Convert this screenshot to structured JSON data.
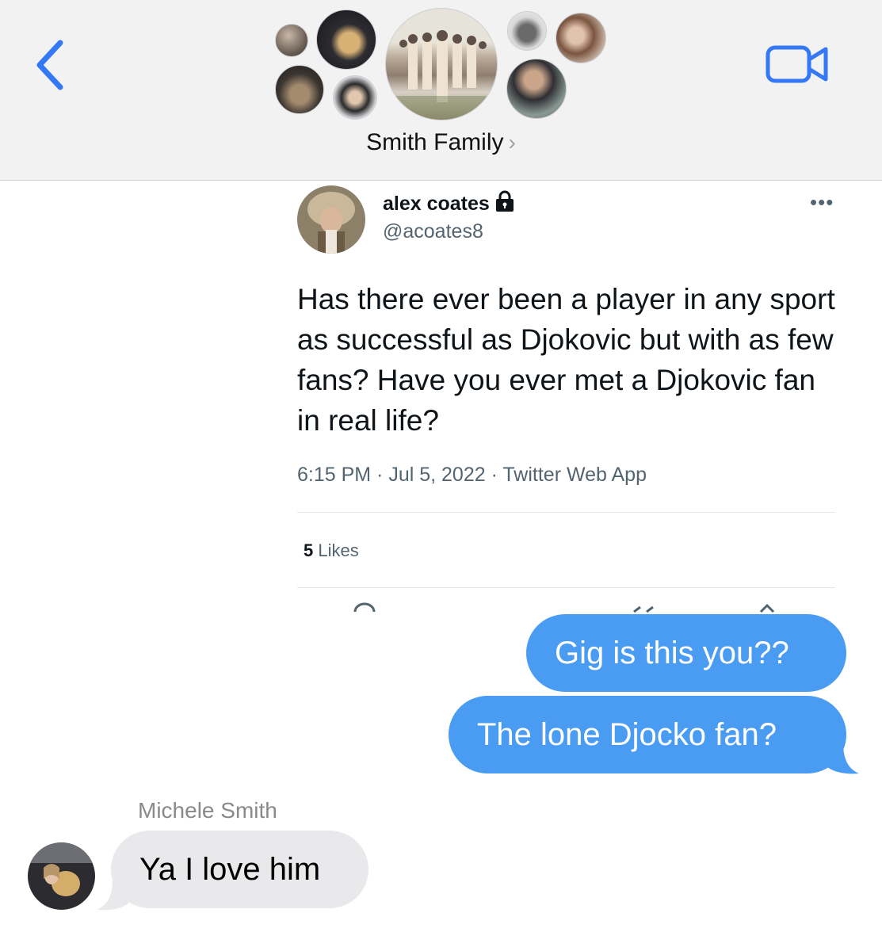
{
  "header": {
    "group_name": "Smith Family",
    "chevron": "›",
    "back_icon": "chevron-left-icon",
    "video_icon": "video-camera-icon",
    "accent_color": "#3478f6",
    "participants_count": 8
  },
  "tweet": {
    "display_name": "alex coates",
    "handle": "@acoates8",
    "protected_icon": "lock-icon",
    "more_label": "•••",
    "text": "Has there ever been a player in any sport as successful as Djokovic but with as few fans?  Have you ever met a Djokovic fan in real life?",
    "meta": "6:15 PM · Jul 5, 2022 · Twitter Web App",
    "likes_count": "5",
    "likes_label": "Likes"
  },
  "messages": {
    "outgoing": [
      {
        "text": "Gig is this you??"
      },
      {
        "text": "The lone Djocko fan?"
      }
    ],
    "incoming": {
      "sender": "Michele Smith",
      "text": "Ya I love him"
    },
    "outgoing_color": "#4a9cf3",
    "incoming_color": "#e9e9eb"
  }
}
